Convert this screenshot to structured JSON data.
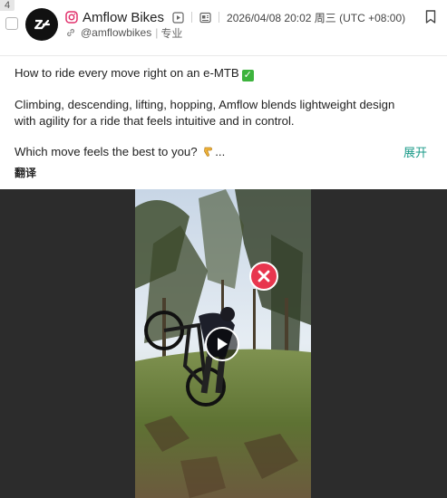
{
  "post": {
    "index": "4",
    "author": {
      "name": "Amflow Bikes",
      "handle": "@amflowbikes",
      "tag": "专业",
      "platform_icon": "instagram-icon"
    },
    "timestamp": "2026/04/08 20:02 周三 (UTC +08:00)",
    "text": {
      "line1": "How to ride every move right on an e-MTB",
      "line2": "Climbing, descending, lifting, hopping, Amflow blends lightweight design with agility for a ride that feels intuitive and in control.",
      "line3": "Which move feels the best to you?",
      "ellipsis": "..."
    },
    "expand_label": "展开",
    "translate_label": "翻译",
    "media": {
      "type": "video",
      "status_icon": "error-x-icon",
      "play_icon": "play-icon"
    }
  },
  "colors": {
    "accent": "#1a9a88",
    "instagram": "#e1306c",
    "error_badge": "#e8364e",
    "video_bg": "#2c2c2c"
  }
}
